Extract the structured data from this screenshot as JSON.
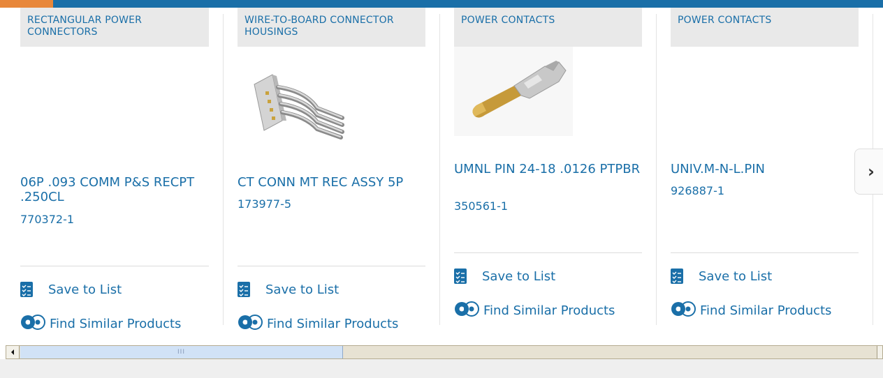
{
  "colors": {
    "brand_blue": "#1a6fa8",
    "accent_orange": "#e8873a",
    "category_bg": "#e9e9e9"
  },
  "cards": [
    {
      "category": "RECTANGULAR POWER CONNECTORS",
      "title": "06P .093 COMM P&S RECPT .250CL",
      "part_number": "770372-1",
      "save_label": "Save to List",
      "similar_label": "Find Similar Products"
    },
    {
      "category": "WIRE-TO-BOARD CONNECTOR HOUSINGS",
      "title": "CT CONN MT REC ASSY 5P",
      "part_number": "173977-5",
      "save_label": "Save to List",
      "similar_label": "Find Similar Products"
    },
    {
      "category": "POWER CONTACTS",
      "title": "UMNL PIN 24-18 .0126 PTPBR",
      "part_number": "350561-1",
      "save_label": "Save to List",
      "similar_label": "Find Similar Products"
    },
    {
      "category": "POWER CONTACTS",
      "title": "UNIV.M-N-L.PIN",
      "part_number": "926887-1",
      "save_label": "Save to List",
      "similar_label": "Find Similar Products"
    }
  ],
  "carousel": {
    "next_icon": "chevron-right-icon",
    "next_glyph": "›"
  },
  "scrollbar": {
    "thumb_grip": "III"
  }
}
